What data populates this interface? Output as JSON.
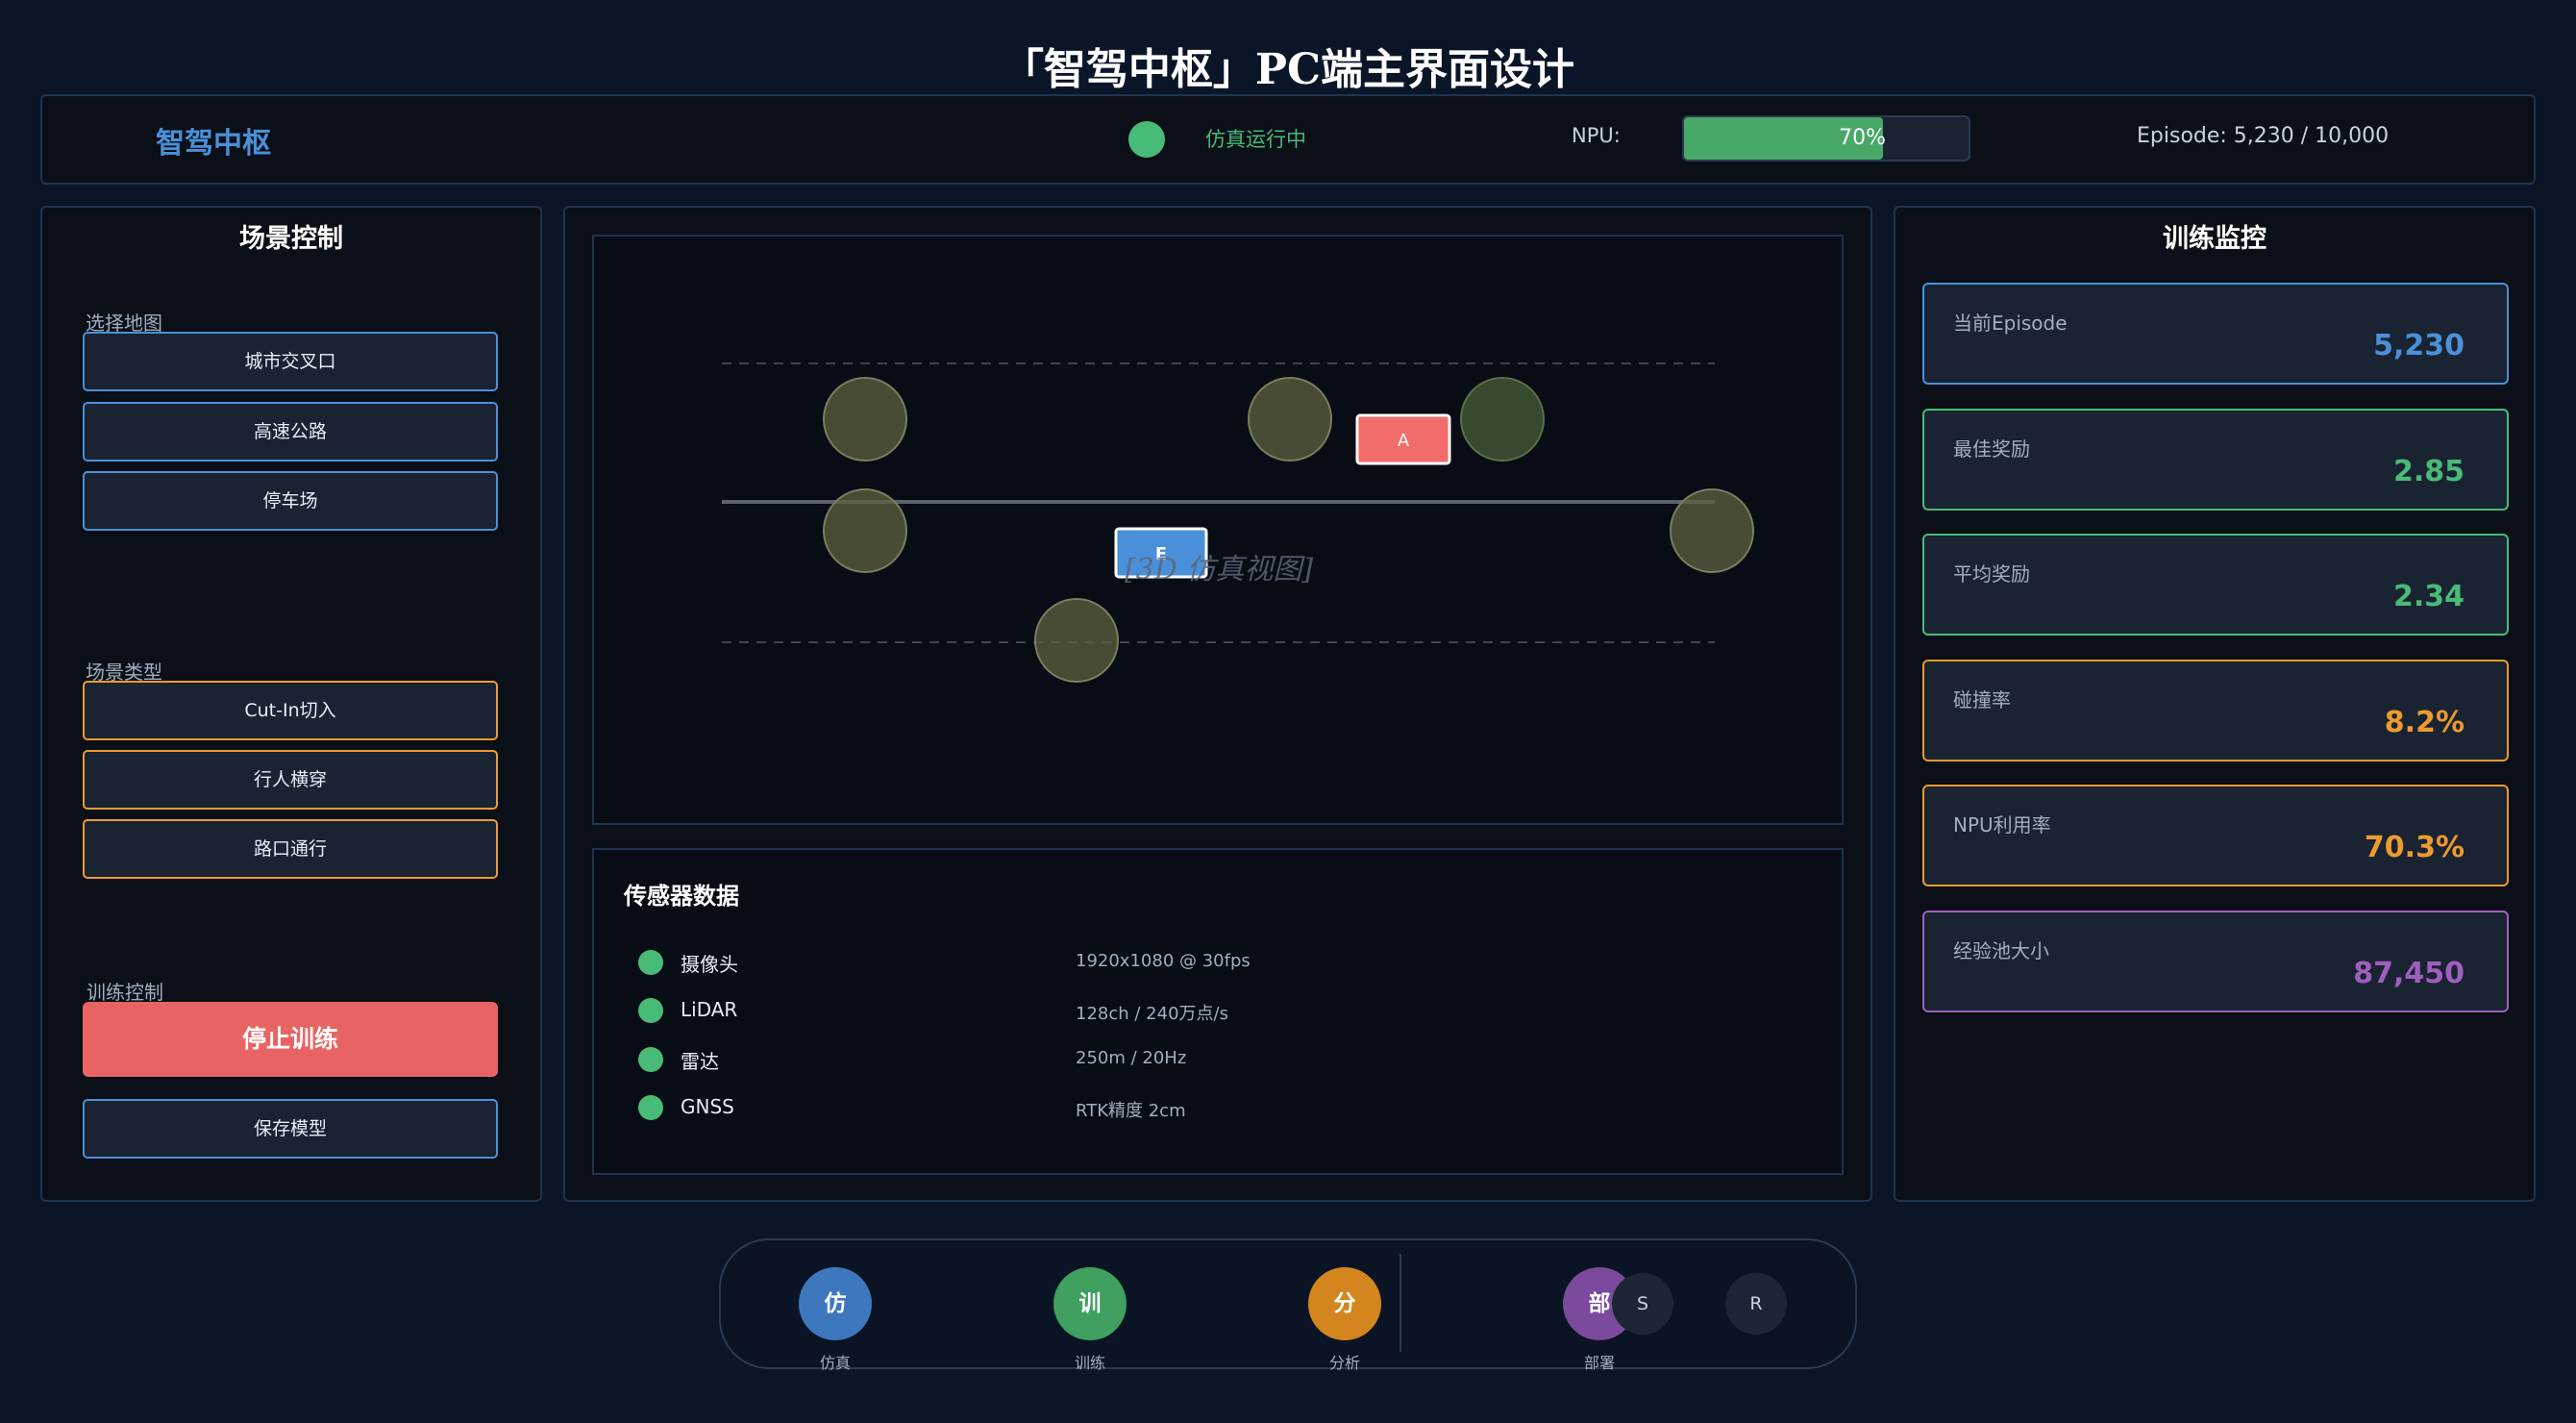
{
  "page_title": "「智驾中枢」PC端主界面设计",
  "header": {
    "brand": "智驾中枢",
    "status_text": "仿真运行中",
    "npu_label": "NPU:",
    "npu_percent": 0.7,
    "npu_text": "70%",
    "episode_text": "Episode: 5,230 / 10,000",
    "status_color": "#48bb78"
  },
  "scene_control": {
    "title": "场景控制",
    "map_label": "选择地图",
    "maps": [
      "城市交叉口",
      "高速公路",
      "停车场"
    ],
    "scene_type_label": "场景类型",
    "scene_types": [
      "Cut-In切入",
      "行人横穿",
      "路口通行"
    ],
    "training_label": "训练控制",
    "stop_label": "停止训练",
    "save_label": "保存模型"
  },
  "sim_view": {
    "placeholder": "[3D 仿真视图]",
    "ego_label": "E",
    "agent_label": "A"
  },
  "sensors": {
    "title": "传感器数据",
    "items": [
      {
        "name": "摄像头",
        "value": "1920x1080 @ 30fps"
      },
      {
        "name": "LiDAR",
        "value": "128ch / 240万点/s"
      },
      {
        "name": "雷达",
        "value": "250m / 20Hz"
      },
      {
        "name": "GNSS",
        "value": "RTK精度 2cm"
      }
    ]
  },
  "monitor": {
    "title": "训练监控",
    "metrics": [
      {
        "label": "当前Episode",
        "value": "5,230",
        "color": "#4a90d9"
      },
      {
        "label": "最佳奖励",
        "value": "2.85",
        "color": "#48bb78"
      },
      {
        "label": "平均奖励",
        "value": "2.34",
        "color": "#48bb78"
      },
      {
        "label": "碰撞率",
        "value": "8.2%",
        "color": "#ed9b2f"
      },
      {
        "label": "NPU利用率",
        "value": "70.3%",
        "color": "#ed9b2f"
      },
      {
        "label": "经验池大小",
        "value": "87,450",
        "color": "#9f5fbf"
      }
    ]
  },
  "dock": {
    "items": [
      {
        "glyph": "仿",
        "label": "仿真",
        "color": "#3d78bf"
      },
      {
        "glyph": "训",
        "label": "训练",
        "color": "#3fa060"
      },
      {
        "glyph": "分",
        "label": "分析",
        "color": "#d4861e"
      },
      {
        "glyph": "部",
        "label": "部署",
        "color": "#7b4a9c"
      }
    ],
    "small_s": "S",
    "small_r": "R"
  }
}
